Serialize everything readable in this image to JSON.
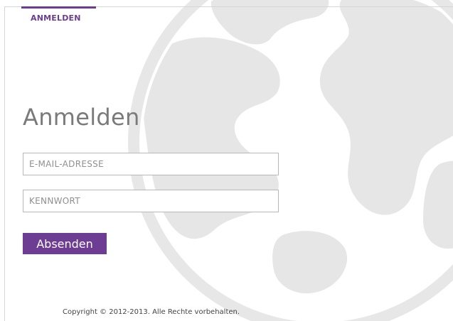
{
  "nav": {
    "tab_label": "ANMELDEN"
  },
  "form": {
    "title": "Anmelden",
    "email_placeholder": "E-MAIL-ADRESSE",
    "password_placeholder": "KENNWORT",
    "submit_label": "Absenden"
  },
  "footer": {
    "copyright": "Copyright © 2012-2013. Alle Rechte vorbehalten."
  },
  "colors": {
    "accent": "#6d3d93",
    "title_text": "#7a7a7a",
    "globe_watermark": "#e6e6e6",
    "field_border": "#b8b8b8"
  },
  "icons": {
    "background": "globe-watermark-icon"
  }
}
